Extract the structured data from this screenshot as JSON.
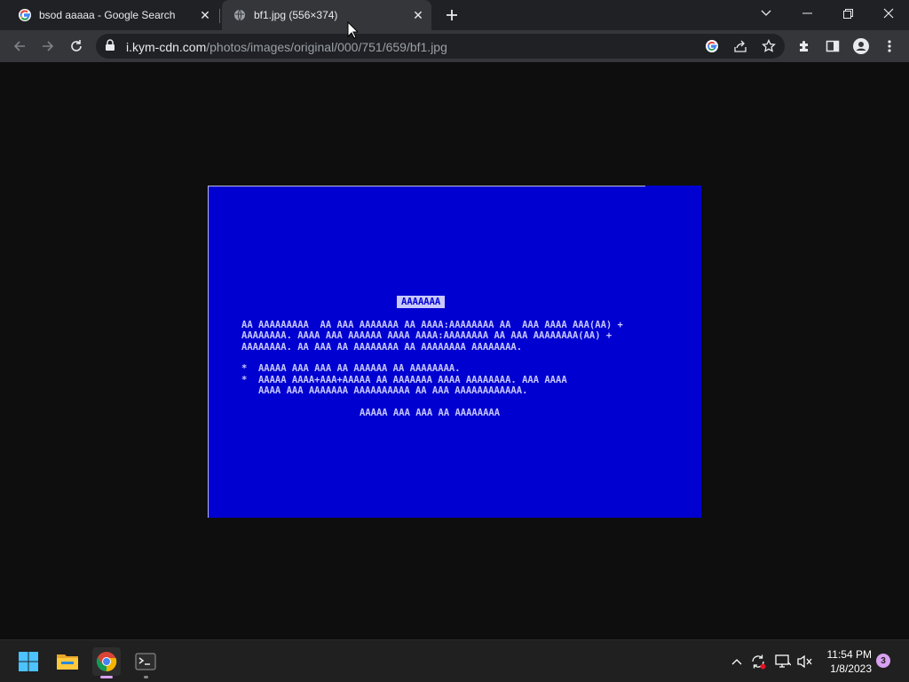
{
  "tabs": [
    {
      "title": "bsod aaaaa - Google Search",
      "icon": "google-icon"
    },
    {
      "title": "bf1.jpg (556×374)",
      "icon": "globe-icon"
    }
  ],
  "address_bar": {
    "host": "i.kym-cdn.com",
    "path": "/photos/images/original/000/751/659/bf1.jpg"
  },
  "image": {
    "header": "AAAAAAA",
    "lines": [
      "AA AAAAAAAAA  AA AAA AAAAAAA AA AAAA:AAAAAAAA AA  AAA AAAA AAA(AA) +",
      "AAAAAAAA. AAAA AAA AAAAAA AAAA AAAA:AAAAAAAA AA AAA AAAAAAAA(AA) +",
      "AAAAAAAA. AA AAA AA AAAAAAAA AA AAAAAAAA AAAAAAAA.",
      "*  AAAAA AAA AAA AA AAAAAA AA AAAAAAAA.",
      "*  AAAAA AAAA+AAA+AAAAA AA AAAAAAA AAAA AAAAAAAA. AAA AAAA",
      "   AAAA AAA AAAAAAA AAAAAAAAAA AA AAA AAAAAAAAAAAA.",
      "AAAAA AAA AAA AA AAAAAAAA"
    ],
    "background_color": "#0000d0",
    "text_color": "#c8c8ff"
  },
  "taskbar": {
    "apps": [
      "windows-start",
      "file-explorer",
      "chrome",
      "terminal"
    ],
    "clock_time": "11:54 PM",
    "clock_date": "1/8/2023",
    "notification_count": "3"
  }
}
